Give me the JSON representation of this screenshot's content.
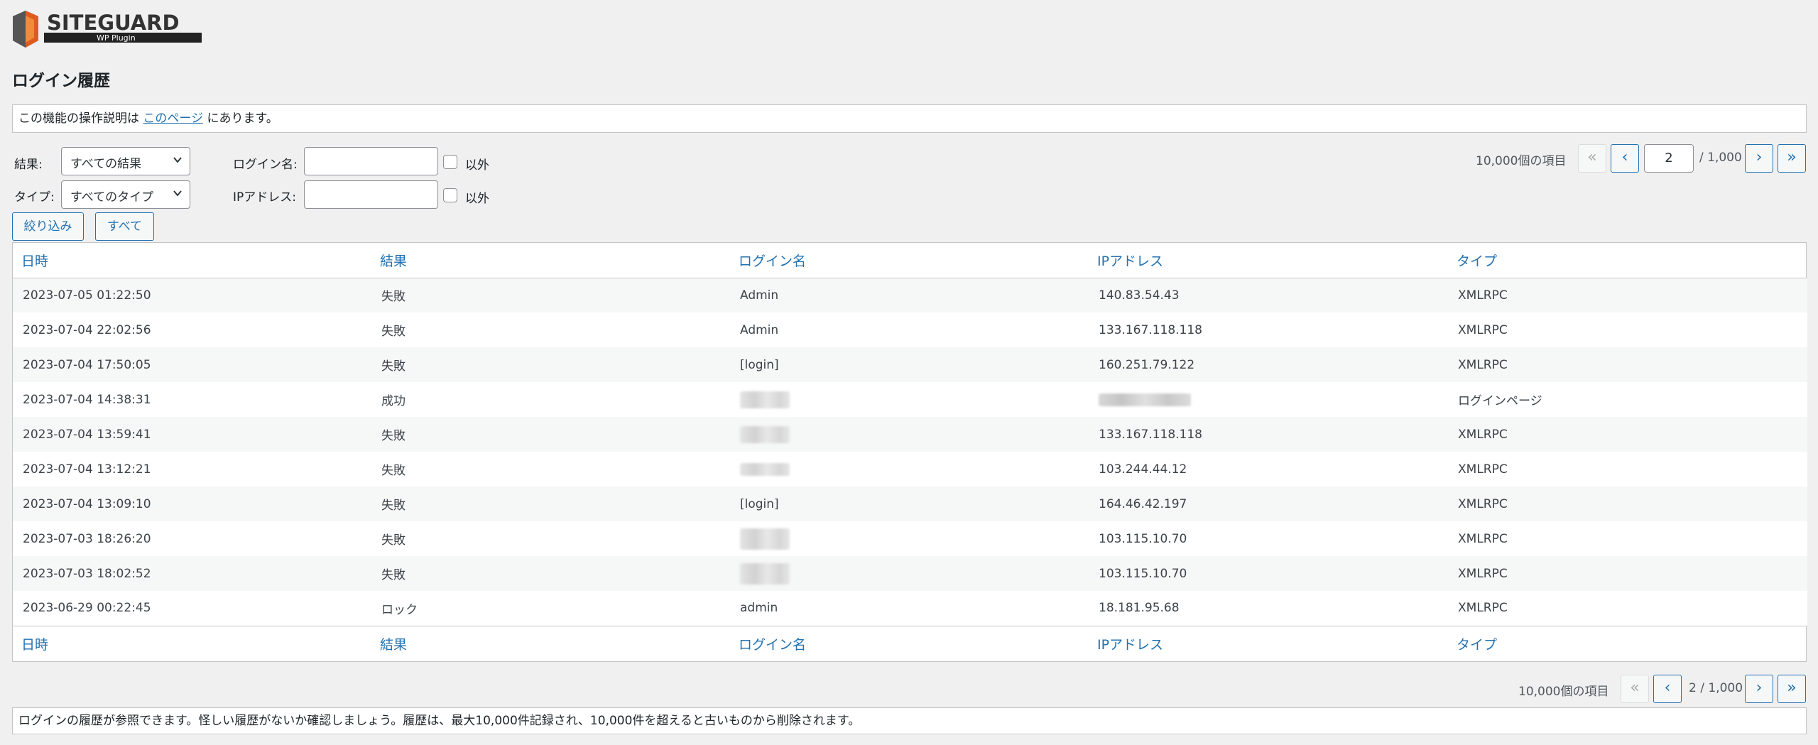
{
  "logo": {
    "brand": "SITEGUARD",
    "sub": "WP Plugin"
  },
  "page_title": "ログイン履歴",
  "notice": {
    "before": "この機能の操作説明は",
    "link": "このページ",
    "after": "にあります。"
  },
  "filters": {
    "result_label": "結果:",
    "result_value": "すべての結果",
    "type_label": "タイプ:",
    "type_value": "すべてのタイプ",
    "login_label": "ログイン名:",
    "ip_label": "IPアドレス:",
    "except_label": "以外",
    "filter_button": "絞り込み",
    "all_button": "すべて"
  },
  "pager_top": {
    "count": "10,000個の項目",
    "current": "2",
    "total": "/ 1,000",
    "first": "«",
    "prev": "‹",
    "next": "›",
    "last": "»"
  },
  "pager_bottom": {
    "count": "10,000個の項目",
    "status": "2 / 1,000",
    "first": "«",
    "prev": "‹",
    "next": "›",
    "last": "»"
  },
  "table": {
    "headers": [
      "日時",
      "結果",
      "ログイン名",
      "IPアドレス",
      "タイプ"
    ],
    "rows": [
      {
        "date": "2023-07-05 01:22:50",
        "result": "失敗",
        "login": "Admin",
        "ip": "140.83.54.43",
        "type": "XMLRPC"
      },
      {
        "date": "2023-07-04 22:02:56",
        "result": "失敗",
        "login": "Admin",
        "ip": "133.167.118.118",
        "type": "XMLRPC"
      },
      {
        "date": "2023-07-04 17:50:05",
        "result": "失敗",
        "login": "[login]",
        "ip": "160.251.79.122",
        "type": "XMLRPC"
      },
      {
        "date": "2023-07-04 14:38:31",
        "result": "成功",
        "login": "",
        "ip": "",
        "type": "ログインページ"
      },
      {
        "date": "2023-07-04 13:59:41",
        "result": "失敗",
        "login": "",
        "ip": "133.167.118.118",
        "type": "XMLRPC"
      },
      {
        "date": "2023-07-04 13:12:21",
        "result": "失敗",
        "login": "",
        "ip": "103.244.44.12",
        "type": "XMLRPC"
      },
      {
        "date": "2023-07-04 13:09:10",
        "result": "失敗",
        "login": "[login]",
        "ip": "164.46.42.197",
        "type": "XMLRPC"
      },
      {
        "date": "2023-07-03 18:26:20",
        "result": "失敗",
        "login": "",
        "ip": "103.115.10.70",
        "type": "XMLRPC"
      },
      {
        "date": "2023-07-03 18:02:52",
        "result": "失敗",
        "login": "",
        "ip": "103.115.10.70",
        "type": "XMLRPC"
      },
      {
        "date": "2023-06-29 00:22:45",
        "result": "ロック",
        "login": "admin",
        "ip": "18.181.95.68",
        "type": "XMLRPC"
      }
    ]
  },
  "footer_notice": "ログインの履歴が参照できます。怪しい履歴がないか確認しましょう。履歴は、最大10,000件記録され、10,000件を超えると古いものから削除されます。",
  "colors": {
    "accent": "#2271b1",
    "background": "#f0f0f1"
  }
}
